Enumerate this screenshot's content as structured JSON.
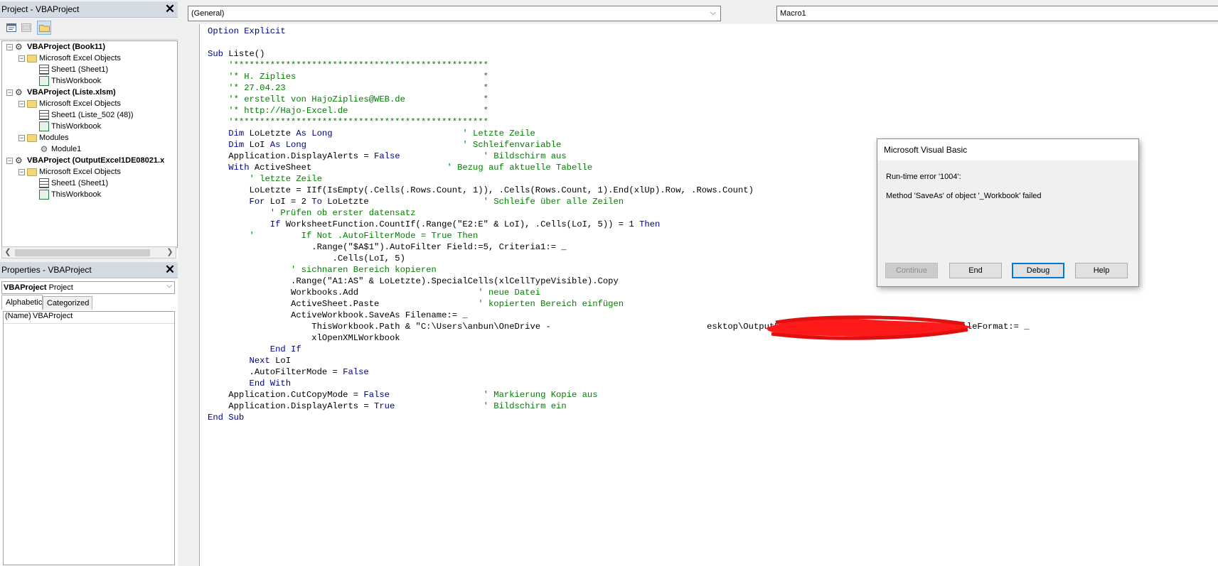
{
  "project": {
    "title": "Project - VBAProject",
    "tree": [
      {
        "label": "VBAProject (Book11)",
        "kind": "project",
        "level": 0,
        "bold": true
      },
      {
        "label": "Microsoft Excel Objects",
        "kind": "folder",
        "level": 1
      },
      {
        "label": "Sheet1 (Sheet1)",
        "kind": "sheet",
        "level": 2
      },
      {
        "label": "ThisWorkbook",
        "kind": "workbook",
        "level": 2
      },
      {
        "label": "VBAProject (Liste.xlsm)",
        "kind": "project",
        "level": 0,
        "bold": true
      },
      {
        "label": "Microsoft Excel Objects",
        "kind": "folder",
        "level": 1
      },
      {
        "label": "Sheet1 (Liste_502 (48))",
        "kind": "sheet",
        "level": 2
      },
      {
        "label": "ThisWorkbook",
        "kind": "workbook",
        "level": 2
      },
      {
        "label": "Modules",
        "kind": "folder",
        "level": 1
      },
      {
        "label": "Module1",
        "kind": "module",
        "level": 2
      },
      {
        "label": "VBAProject (OutputExcel1DE08021.x",
        "kind": "project",
        "level": 0,
        "bold": true
      },
      {
        "label": "Microsoft Excel Objects",
        "kind": "folder",
        "level": 1
      },
      {
        "label": "Sheet1 (Sheet1)",
        "kind": "sheet",
        "level": 2
      },
      {
        "label": "ThisWorkbook",
        "kind": "workbook",
        "level": 2
      }
    ]
  },
  "properties": {
    "title": "Properties - VBAProject",
    "object_name": "VBAProject",
    "object_type": "Project",
    "tabs": [
      "Alphabetic",
      "Categorized"
    ],
    "rows": [
      {
        "key": "(Name)",
        "value": "VBAProject"
      }
    ]
  },
  "code": {
    "object_combo": "(General)",
    "proc_combo": "Macro1",
    "lines": [
      [
        [
          "kw",
          "Option Explicit"
        ]
      ],
      [],
      [
        [
          "kw",
          "Sub "
        ],
        [
          "tx",
          "Liste()"
        ]
      ],
      [
        [
          "cm",
          "    '*************************************************"
        ]
      ],
      [
        [
          "cm",
          "    '* H. Ziplies                                    *"
        ]
      ],
      [
        [
          "cm",
          "    '* 27.04.23                                      *"
        ]
      ],
      [
        [
          "cm",
          "    '* erstellt von HajoZiplies@WEB.de               *"
        ]
      ],
      [
        [
          "cm",
          "    '* http://Hajo-Excel.de                          *"
        ]
      ],
      [
        [
          "cm",
          "    '*************************************************"
        ]
      ],
      [
        [
          "kw",
          "    Dim "
        ],
        [
          "tx",
          "LoLetzte "
        ],
        [
          "kw",
          "As Long"
        ],
        [
          "tx",
          "                         "
        ],
        [
          "cm",
          "' Letzte Zeile"
        ]
      ],
      [
        [
          "kw",
          "    Dim "
        ],
        [
          "tx",
          "LoI "
        ],
        [
          "kw",
          "As Long"
        ],
        [
          "tx",
          "                              "
        ],
        [
          "cm",
          "' Schleifenvariable"
        ]
      ],
      [
        [
          "tx",
          "    Application.DisplayAlerts = "
        ],
        [
          "kw",
          "False"
        ],
        [
          "tx",
          "                "
        ],
        [
          "cm",
          "' Bildschirm aus"
        ]
      ],
      [
        [
          "kw",
          "    With "
        ],
        [
          "tx",
          "ActiveSheet                          "
        ],
        [
          "cm",
          "' Bezug auf aktuelle Tabelle"
        ]
      ],
      [
        [
          "cm",
          "        ' letzte Zeile"
        ]
      ],
      [
        [
          "tx",
          "        LoLetzte = IIf(IsEmpty(.Cells(.Rows.Count, 1)), .Cells(Rows.Count, 1).End(xlUp).Row, .Rows.Count)"
        ]
      ],
      [
        [
          "kw",
          "        For "
        ],
        [
          "tx",
          "LoI = 2 "
        ],
        [
          "kw",
          "To "
        ],
        [
          "tx",
          "LoLetzte                      "
        ],
        [
          "cm",
          "' Schleife über alle Zeilen"
        ]
      ],
      [
        [
          "cm",
          "            ' Prüfen ob erster datensatz"
        ]
      ],
      [
        [
          "kw",
          "            If "
        ],
        [
          "tx",
          "WorksheetFunction.CountIf(.Range(\"E2:E\" & LoI), .Cells(LoI, 5)) = 1 "
        ],
        [
          "kw",
          "Then"
        ]
      ],
      [
        [
          "cm",
          "        '         If Not .AutoFilterMode = True Then"
        ]
      ],
      [
        [
          "tx",
          "                    .Range(\"$A$1\").AutoFilter Field:=5, Criteria1:= _"
        ]
      ],
      [
        [
          "tx",
          "                        .Cells(LoI, 5)"
        ]
      ],
      [
        [
          "cm",
          "                ' sichnaren Bereich kopieren"
        ]
      ],
      [
        [
          "tx",
          "                .Range(\"A1:AS\" & LoLetzte).SpecialCells(xlCellTypeVisible).Copy"
        ]
      ],
      [
        [
          "tx",
          "                Workbooks.Add                       "
        ],
        [
          "cm",
          "' neue Datei"
        ]
      ],
      [
        [
          "tx",
          "                ActiveSheet.Paste                   "
        ],
        [
          "cm",
          "' kopierten Bereich einfügen"
        ]
      ],
      [
        [
          "tx",
          "                ActiveWorkbook.SaveAs Filename:= _"
        ]
      ],
      [
        [
          "tx",
          "                    ThisWorkbook.Path & \"C:\\Users\\anbun\\OneDrive -                              esktop\\OutputExcel\" & .Cells(LoI, 5) & \".xlsx\", FileFormat:= _"
        ]
      ],
      [
        [
          "tx",
          "                    xlOpenXMLWorkbook"
        ]
      ],
      [
        [
          "kw",
          "            End If"
        ]
      ],
      [
        [
          "kw",
          "        Next "
        ],
        [
          "tx",
          "LoI"
        ]
      ],
      [
        [
          "tx",
          "        .AutoFilterMode = "
        ],
        [
          "kw",
          "False"
        ]
      ],
      [
        [
          "kw",
          "        End With"
        ]
      ],
      [
        [
          "tx",
          "    Application.CutCopyMode = "
        ],
        [
          "kw",
          "False"
        ],
        [
          "tx",
          "                  "
        ],
        [
          "cm",
          "' Markierung Kopie aus"
        ]
      ],
      [
        [
          "tx",
          "    Application.DisplayAlerts = "
        ],
        [
          "kw",
          "True"
        ],
        [
          "tx",
          "                 "
        ],
        [
          "cm",
          "' Bildschirm ein"
        ]
      ],
      [
        [
          "kw",
          "End Sub"
        ]
      ]
    ]
  },
  "dialog": {
    "title": "Microsoft Visual Basic",
    "error_line": "Run-time error '1004':",
    "message": "Method 'SaveAs' of object '_Workbook' failed",
    "buttons": {
      "continue": "Continue",
      "end": "End",
      "debug": "Debug",
      "help": "Help"
    }
  },
  "colors": {
    "keyword": "#00008b",
    "comment": "#008000",
    "redaction": "#ff1a1a"
  }
}
